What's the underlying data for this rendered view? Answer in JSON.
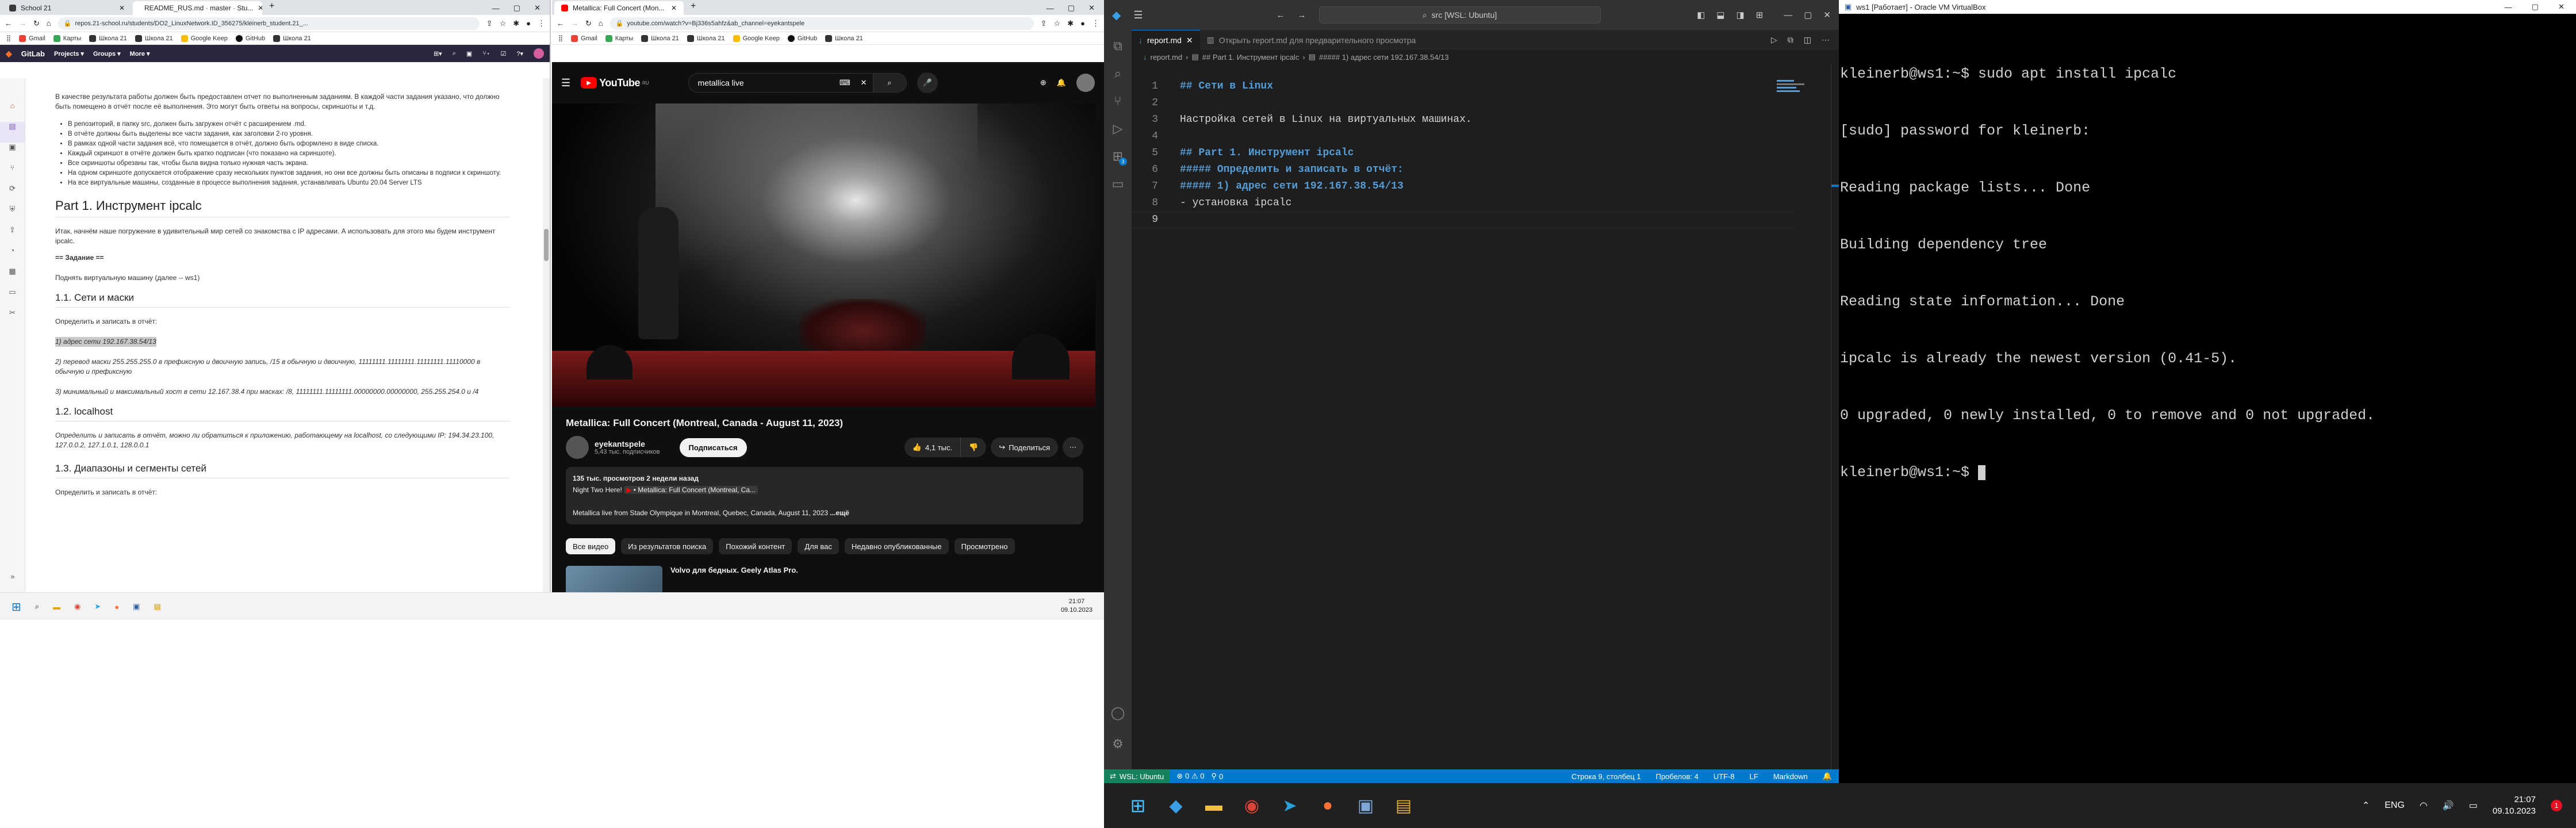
{
  "left_browser": {
    "tabs": [
      {
        "label": "School 21"
      },
      {
        "label": "README_RUS.md · master · Stu..."
      }
    ],
    "url": "repos.21-school.ru/students/DO2_LinuxNetwork.ID_356275/kleinerb_student.21_...",
    "bookmarks": [
      {
        "label": "Gmail"
      },
      {
        "label": "Карты"
      },
      {
        "label": "Школа 21"
      },
      {
        "label": "Школа 21"
      },
      {
        "label": "Google Keep"
      },
      {
        "label": "GitHub"
      },
      {
        "label": "Школа 21"
      }
    ],
    "gitlab": {
      "brand": "GitLab",
      "menu": [
        "Projects",
        "Groups",
        "More"
      ]
    },
    "doc": {
      "intro": "В качестве результата работы должен быть предоставлен отчет по выполненным заданиям. В каждой части задания указано, что должно быть помещено в отчёт после её выполнения. Это могут быть ответы на вопросы, скриншоты и т.д.",
      "bullets": [
        "В репозиторий, в папку src, должен быть загружен отчёт с расширением .md.",
        "В отчёте должны быть выделены все части задания, как заголовки 2-го уровня.",
        "В рамках одной части задания всё, что помещается в отчёт, должно быть оформлено в виде списка.",
        "Каждый скриншот в отчёте должен быть кратко подписан (что показано на скриншоте).",
        "Все скриншоты обрезаны так, чтобы была видна только нужная часть экрана.",
        "На одном скриншоте допускается отображение сразу нескольких пунктов задания, но они все должны быть описаны в подписи к скриншоту.",
        "На все виртуальные машины, созданные в процессе выполнения задания, устанавливать Ubuntu 20.04 Server LTS"
      ],
      "part1_title": "Part 1. Инструмент ipcalc",
      "part1_intro": "Итак, начнём наше погружение в удивительный мир сетей со знакомства с IP адресами. А использовать для этого мы будем инструмент ipcalc.",
      "task_label": "== Задание ==",
      "task_text": "Поднять виртуальную машину (далее -- ws1)",
      "s11_title": "1.1. Сети и маски",
      "s11_lead": "Определить и записать в отчёт:",
      "s11_item1": "1) адрес сети 192.167.38.54/13",
      "s11_item2": "2) перевод маски 255.255.255.0 в префиксную и двоичную запись, /15 в обычную и двоичную, 11111111.11111111.11111111.11110000 в обычную и префиксную",
      "s11_item3": "3) минимальный и максимальный хост в сети 12.167.38.4 при масках: /8, 11111111.11111111.00000000.00000000, 255.255.254.0 и /4",
      "s12_title": "1.2. localhost",
      "s12_text": "Определить и записать в отчёт, можно ли обратиться к приложению, работающему на localhost, со следующими IP: 194.34.23.100, 127.0.0.2, 127.1.0.1, 128.0.0.1",
      "s13_title": "1.3. Диапазоны и сегменты сетей",
      "s13_lead": "Определить и записать в отчёт:"
    }
  },
  "youtube": {
    "tab": "Metallica: Full Concert (Mon...",
    "url": "youtube.com/watch?v=Bj336s5ahfz&ab_channel=eyekantspele",
    "bookmarks": [
      {
        "label": "Gmail"
      },
      {
        "label": "Карты"
      },
      {
        "label": "Школа 21"
      },
      {
        "label": "Школа 21"
      },
      {
        "label": "Google Keep"
      },
      {
        "label": "GitHub"
      },
      {
        "label": "Школа 21"
      }
    ],
    "logo": "YouTube",
    "logo_suffix": "RU",
    "search": "metallica live",
    "video_title": "Metallica: Full Concert (Montreal, Canada - August 11, 2023)",
    "channel": "eyekantspele",
    "subs": "5,43 тыс. подписчиков",
    "subscribe": "Подписаться",
    "likes": "4,1 тыс.",
    "share": "Поделиться",
    "desc_stats": "135 тыс. просмотров  2 недели назад",
    "desc_line": "Night Two Here!",
    "desc_link": "Metallica: Full Concert (Montreal, Ca...",
    "desc_line2": "Metallica live from Stade Olympique in Montreal, Quebec, Canada, August 11, 2023",
    "desc_more": "...ещё",
    "chips": [
      "Все видео",
      "Из результатов поиска",
      "Похожий контент",
      "Для вас",
      "Недавно опубликованные",
      "Просмотрено"
    ],
    "rec_title": "Volvo для бедных. Geely Atlas Pro."
  },
  "left_taskbar": {
    "time": "21:07",
    "date": "09.10.2023"
  },
  "vscode": {
    "search": "src [WSL: Ubuntu]",
    "tabs": [
      {
        "label": "report.md"
      },
      {
        "label": "Открыть report.md для предварительного просмотра"
      }
    ],
    "breadcrumb": [
      "report.md",
      "## Part 1. Инструмент ipcalc",
      "##### 1) адрес сети 192.167.38.54/13"
    ],
    "lines": [
      {
        "n": "1",
        "text": "## Сети в Linux",
        "kind": "h"
      },
      {
        "n": "2",
        "text": "",
        "kind": "t"
      },
      {
        "n": "3",
        "text": "Настройка сетей в Linux на виртуальных машинах.",
        "kind": "t"
      },
      {
        "n": "4",
        "text": "",
        "kind": "t"
      },
      {
        "n": "5",
        "text": "## Part 1. Инструмент ipcalc",
        "kind": "h"
      },
      {
        "n": "6",
        "text": "##### Определить и записать в отчёт:",
        "kind": "h"
      },
      {
        "n": "7",
        "text": "##### 1) адрес сети 192.167.38.54/13",
        "kind": "h"
      },
      {
        "n": "8",
        "text": "- установка ipcalc",
        "kind": "t"
      },
      {
        "n": "9",
        "text": "",
        "kind": "t"
      }
    ],
    "status": {
      "remote": "WSL: Ubuntu",
      "problems": "0 ⚠ 0",
      "ports": "0",
      "position": "Строка 9, столбец 1",
      "spaces": "Пробелов: 4",
      "encoding": "UTF-8",
      "eol": "LF",
      "lang": "Markdown"
    },
    "accent": "#007acc"
  },
  "terminal": {
    "title": "ws1 [Работает] - Oracle VM VirtualBox",
    "lines": [
      "kleinerb@ws1:~$ sudo apt install ipcalc",
      "[sudo] password for kleinerb:",
      "Reading package lists... Done",
      "Building dependency tree",
      "Reading state information... Done",
      "ipcalc is already the newest version (0.41-5).",
      "0 upgraded, 0 newly installed, 0 to remove and 0 not upgraded.",
      "kleinerb@ws1:~$ "
    ]
  },
  "taskbar": {
    "lang": "ENG",
    "time": "21:07",
    "date": "09.10.2023",
    "notif": "1"
  }
}
